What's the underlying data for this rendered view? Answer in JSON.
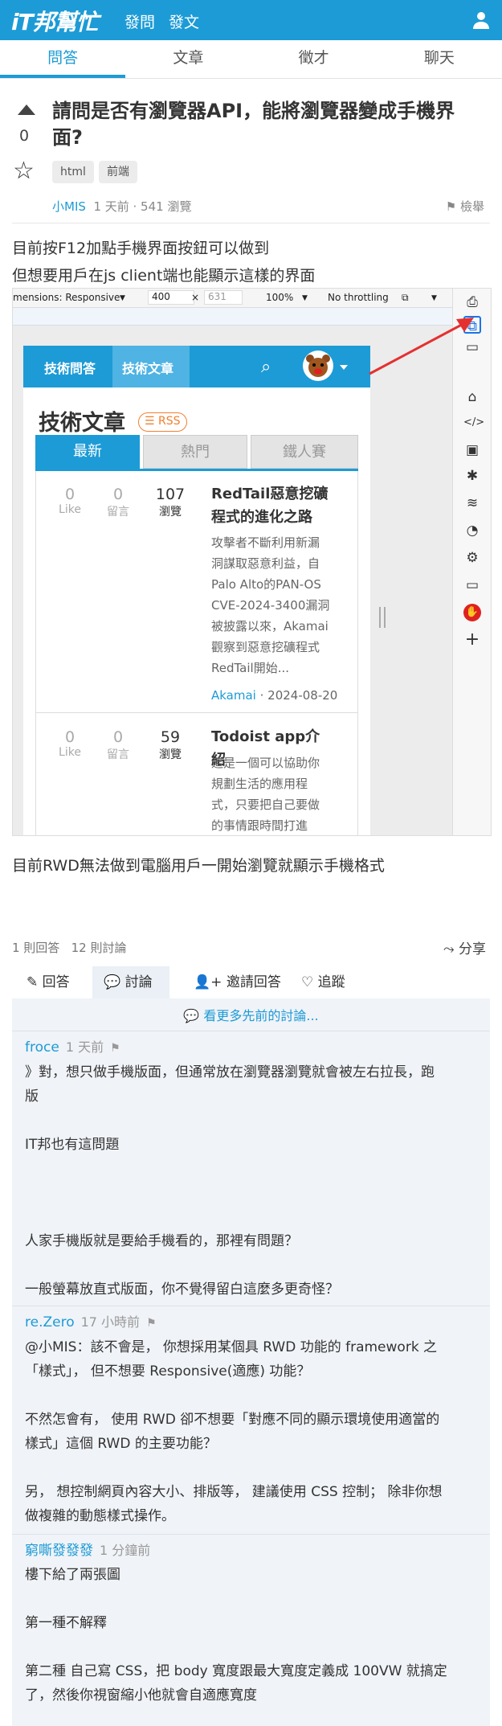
{
  "header": {
    "logo": "iT邦幫忙",
    "nav_ask": "發問",
    "nav_post": "發文"
  },
  "tabs": [
    {
      "label": "問答"
    },
    {
      "label": "文章"
    },
    {
      "label": "徵才"
    },
    {
      "label": "聊天"
    }
  ],
  "question": {
    "vote_count": "0",
    "title": "請問是否有瀏覽器API，能將瀏覽器變成手機界面?",
    "tags": [
      "html",
      "前端"
    ],
    "author": "小MIS",
    "meta": "1 天前 ‧ 541 瀏覽",
    "report": "檢舉",
    "body_line1": "目前按F12加點手機界面按鈕可以做到",
    "body_line2": "但想要用戶在js client端也能顯示這樣的界面",
    "body_line3": "目前RWD無法做到電腦用戶一開始瀏覽就顯示手機格式"
  },
  "screenshot": {
    "dim_label": "mensions: Responsive",
    "width": "400",
    "x": "×",
    "height": "631",
    "zoom": "100%",
    "throttle": "No throttling",
    "nav_qa": "技術問答",
    "nav_articles": "技術文章",
    "page_title": "技術文章",
    "rss": "RSS",
    "tab_new": "最新",
    "tab_hot": "熱門",
    "tab_iron": "鐵人賽",
    "posts": [
      {
        "like": "0",
        "like_label": "Like",
        "comments": "0",
        "comments_label": "留言",
        "views": "107",
        "views_label": "瀏覽",
        "title": "RedTail惡意挖礦程式的進化之路",
        "desc": [
          "攻擊者不斷利用新漏",
          "洞謀取惡意利益，自",
          "Palo Alto的PAN-OS",
          "CVE-2024-3400漏洞",
          "被披露以來，Akamai",
          "觀察到惡意挖礦程式",
          "RedTail開始..."
        ],
        "author": "Akamai",
        "date": "‧ 2024-08-20"
      },
      {
        "like": "0",
        "like_label": "Like",
        "comments": "0",
        "comments_label": "留言",
        "views": "59",
        "views_label": "瀏覽",
        "title": "Todoist app介紹",
        "desc": [
          "這是一個可以協助你",
          "規劃生活的應用程",
          "式，只要把自己要做",
          "的事情跟時間打進"
        ],
        "author": "",
        "date": ""
      }
    ]
  },
  "answers": {
    "count": "1 則回答",
    "discussions": "12 則討論",
    "share": "分享"
  },
  "action_tabs": [
    {
      "label": "回答"
    },
    {
      "label": "討論"
    },
    {
      "label": "邀請回答"
    },
    {
      "label": "追蹤"
    }
  ],
  "more_discussions": "看更多先前的討論...",
  "comments": [
    {
      "author": "froce",
      "time": "1 天前",
      "lines": [
        "》對，想只做手機版面，但通常放在瀏覽器瀏覽就會被左右拉長，跑",
        "版",
        "",
        "IT邦也有這問題",
        "",
        "",
        "",
        "人家手機版就是要給手機看的，那裡有問題？",
        "",
        "一般螢幕放直式版面，你不覺得留白這麼多更奇怪？"
      ]
    },
    {
      "author": "re.Zero",
      "time": "17 小時前",
      "lines": [
        "@小MIS：該不會是， 你想採用某個具 RWD 功能的 framework 之",
        "「樣式」， 但不想要 Responsive(適應) 功能？",
        "",
        "不然怎會有， 使用 RWD 卻不想要「對應不同的顯示環境使用適當的",
        "樣式」這個 RWD 的主要功能？",
        "",
        "另， 想控制網頁內容大小、排版等， 建議使用 CSS 控制； 除非你想",
        "做複雜的動態樣式操作。"
      ]
    },
    {
      "author": "窮嘶發發發",
      "time": "1 分鐘前",
      "lines": [
        "樓下給了兩張圖",
        "",
        "第一種不解釋",
        "",
        "第二種 自己寫 CSS，把 body 寬度跟最大寬度定義成 100VW 就搞定",
        "了，然後你視窗縮小他就會自適應寬度"
      ]
    }
  ]
}
